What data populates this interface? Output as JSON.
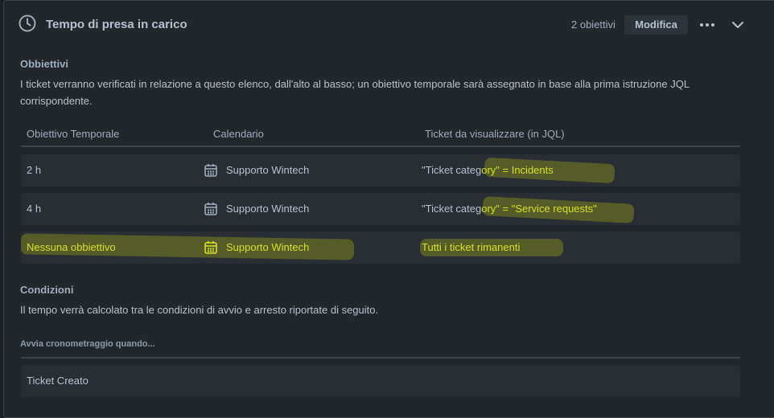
{
  "header": {
    "title": "Tempo di presa in carico",
    "goals_count": "2 obiettivi",
    "edit_label": "Modifica"
  },
  "goals": {
    "heading": "Obbiettivi",
    "description": "I ticket verranno verificati in relazione a questo elenco, dall'alto al basso; un obiettivo temporale sarà assegnato in base alla prima istruzione JQL corrispondente.",
    "columns": [
      "Obiettivo Temporale",
      "Calendario",
      "Ticket da visualizzare (in JQL)"
    ],
    "rows": [
      {
        "goal": "2 h",
        "calendar": "Supporto Wintech",
        "jql_a": "\"Ticket categ",
        "jql_b": "ory\" = Incidents"
      },
      {
        "goal": "4 h",
        "calendar": "Supporto Wintech",
        "jql_a": "\"Ticket categ",
        "jql_b": "ory\" = \"Service requests\""
      },
      {
        "goal": "Nessuna obbiettivo",
        "calendar": "Supporto Wintech",
        "jql": "Tutti i ticket rimanenti"
      }
    ]
  },
  "conditions": {
    "heading": "Condizioni",
    "description": "Il tempo verrà calcolato tra le condizioni di avvio e arresto riportate di seguito.",
    "start_subheading": "Avvia cronometraggio quando...",
    "start_item": "Ticket Creato"
  },
  "colors": {
    "background": "#1d2125",
    "panel": "#22272b",
    "row": "#282e33",
    "text": "#b6c2cf",
    "highlight": "#cfd40f"
  },
  "icons": [
    "clock-icon",
    "more-icon",
    "chevron-down-icon",
    "calendar-icon"
  ]
}
